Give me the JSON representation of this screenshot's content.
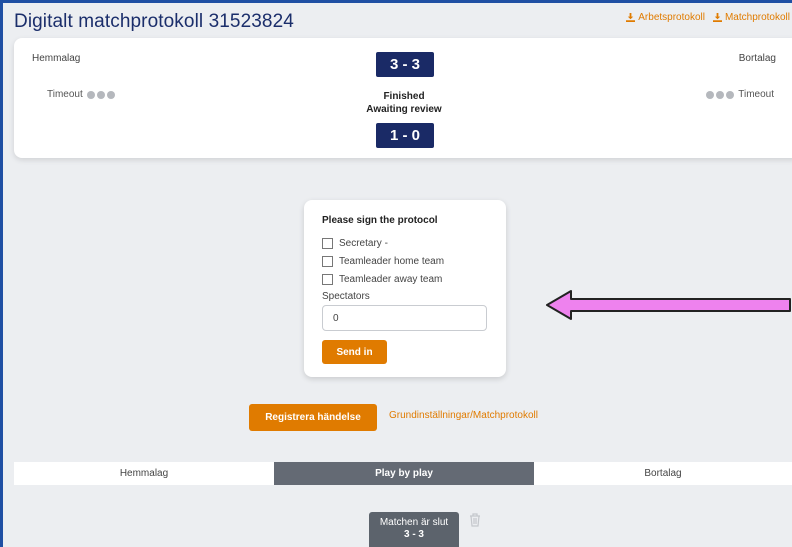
{
  "header": {
    "title": "Digitalt matchprotokoll 31523824",
    "links": [
      {
        "label": "Arbetsprotokoll",
        "icon": "download-icon"
      },
      {
        "label": "Matchprotokoll",
        "icon": "download-icon"
      }
    ]
  },
  "scoreboard": {
    "home_label": "Hemmalag",
    "away_label": "Bortalag",
    "timeout_label": "Timeout",
    "score": "3 - 3",
    "period_score": "1 - 0",
    "status_line1": "Finished",
    "status_line2": "Awaiting review"
  },
  "sign_form": {
    "title": "Please sign the protocol",
    "checks": [
      {
        "label": "Secretary -"
      },
      {
        "label": "Teamleader home team"
      },
      {
        "label": "Teamleader away team"
      }
    ],
    "spectators_label": "Spectators",
    "spectators_value": "0",
    "send_label": "Send in"
  },
  "actions": {
    "register_label": "Registrera händelse",
    "settings_link": "Grundinställningar/Matchprotokoll"
  },
  "tabs": [
    {
      "label": "Hemmalag"
    },
    {
      "label": "Play by play"
    },
    {
      "label": "Bortalag"
    }
  ],
  "event": {
    "title": "Matchen är slut",
    "score": "3 - 3"
  },
  "colors": {
    "accent": "#e07b00",
    "navy": "#1a2a66",
    "annotation_arrow": "#ee82ee"
  }
}
